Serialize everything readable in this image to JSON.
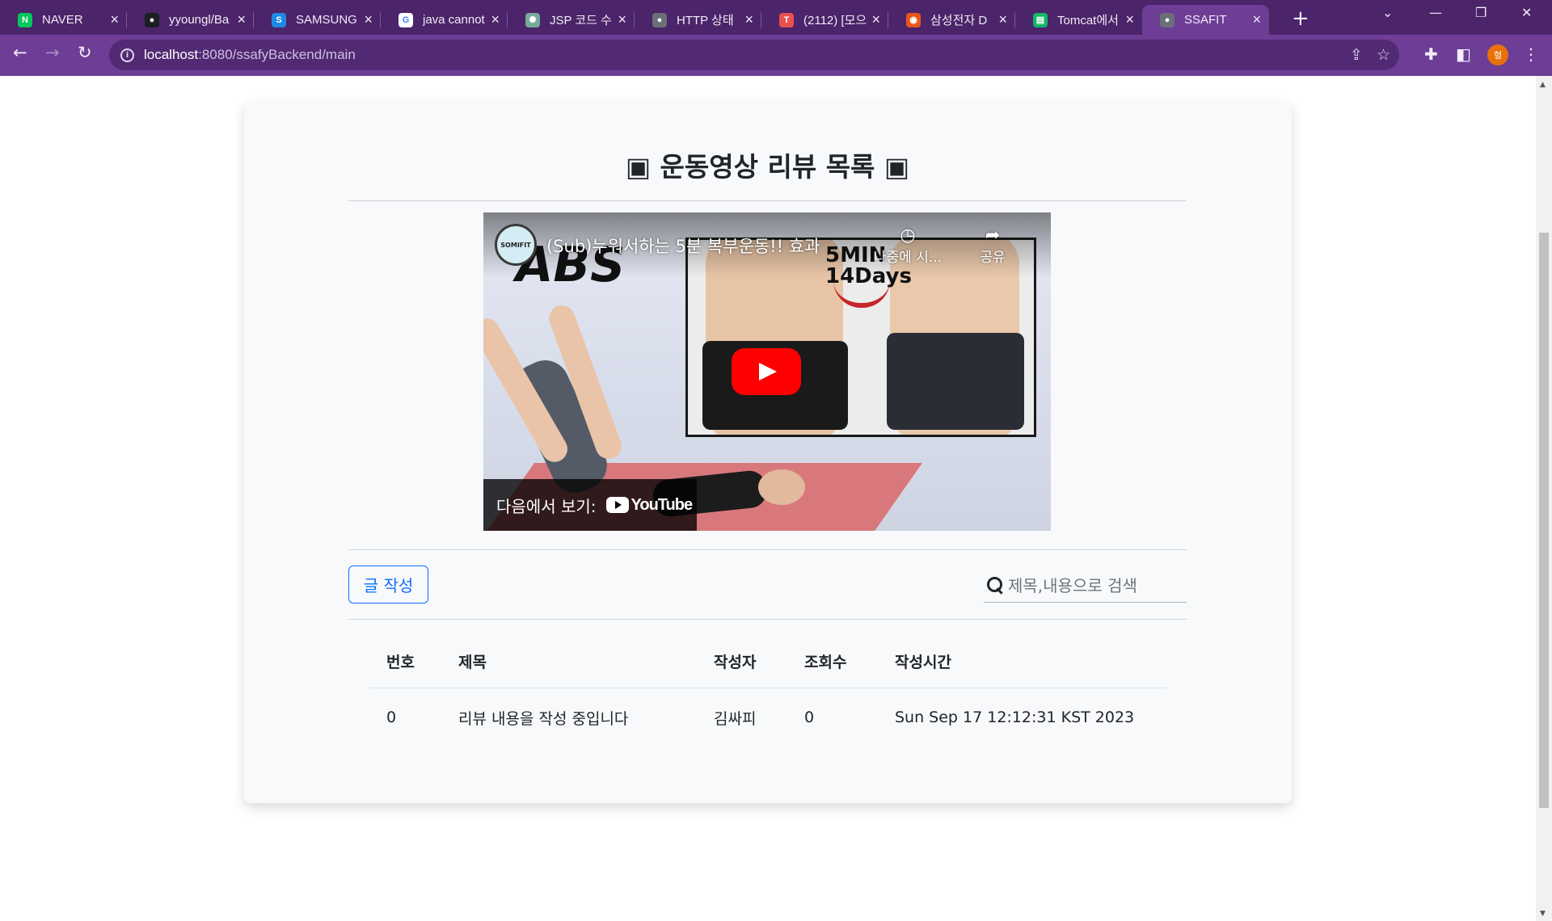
{
  "browser": {
    "tabs": [
      {
        "label": "NAVER",
        "icon": "naver-icon",
        "color": "#03c75a",
        "glyph": "N"
      },
      {
        "label": "yyoungl/Ba",
        "icon": "github-icon",
        "color": "#1b1f23",
        "glyph": "●"
      },
      {
        "label": "SAMSUNG",
        "icon": "samsung-icon",
        "color": "#1e88e5",
        "glyph": "S"
      },
      {
        "label": "java cannot",
        "icon": "google-icon",
        "color": "#ffffff",
        "glyph": "G"
      },
      {
        "label": "JSP 코드 수",
        "icon": "chatgpt-icon",
        "color": "#74aa9c",
        "glyph": "✺"
      },
      {
        "label": "HTTP 상태",
        "icon": "globe-icon",
        "color": "#6b6f77",
        "glyph": "●"
      },
      {
        "label": "(2112) [모으",
        "icon": "tcode-icon",
        "color": "#e8504f",
        "glyph": "T"
      },
      {
        "label": "삼성전자 D",
        "icon": "samsung-d-icon",
        "color": "#e8571a",
        "glyph": "◉"
      },
      {
        "label": "Tomcat에서",
        "icon": "tomcat-doc-icon",
        "color": "#12b76a",
        "glyph": "▤"
      },
      {
        "label": "SSAFIT",
        "icon": "globe-icon",
        "color": "#6b6f77",
        "glyph": "●",
        "active": true
      }
    ],
    "url_host": "localhost",
    "url_rest": ":8080/ssafyBackend/main",
    "profile_initial": "형"
  },
  "page": {
    "title": "▣ 운동영상 리뷰 목록 ▣",
    "video": {
      "channel": "SOMIFIT",
      "title": "(Sub)누워서하는 5분 복부운동!! 효과",
      "watch_later": "나중에 시...",
      "share": "공유",
      "watch_on": "다음에서 보기:",
      "youtube": "YouTube",
      "thumb_big_text": "ABS",
      "thumb_inset_text": "5MIN 14Days"
    },
    "write_button": "글 작성",
    "search_placeholder": "제목,내용으로 검색",
    "table": {
      "headers": [
        "번호",
        "제목",
        "작성자",
        "조회수",
        "작성시간"
      ],
      "rows": [
        [
          "0",
          "리뷰 내용을 작성 중입니다",
          "김싸피",
          "0",
          "Sun Sep 17 12:12:31 KST 2023"
        ]
      ]
    }
  }
}
